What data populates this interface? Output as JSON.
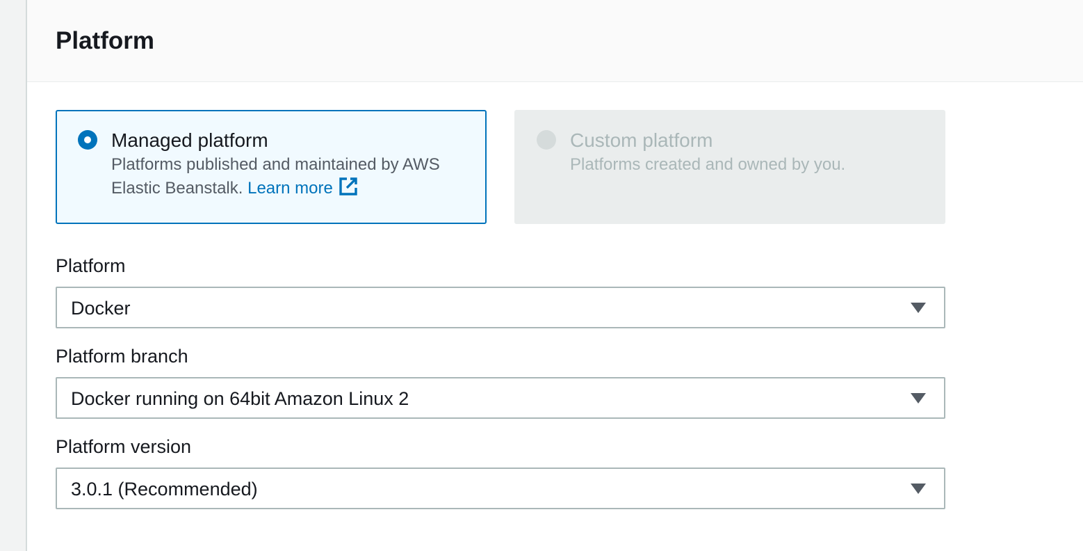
{
  "section": {
    "title": "Platform"
  },
  "tiles": {
    "managed": {
      "title": "Managed platform",
      "description": "Platforms published and maintained by AWS Elastic Beanstalk.",
      "link_label": "Learn more",
      "selected": true,
      "icon": "external-link-icon"
    },
    "custom": {
      "title": "Custom platform",
      "description": "Platforms created and owned by you.",
      "disabled": true
    }
  },
  "fields": {
    "platform": {
      "label": "Platform",
      "value": "Docker"
    },
    "platform_branch": {
      "label": "Platform branch",
      "value": "Docker running on 64bit Amazon Linux 2"
    },
    "platform_version": {
      "label": "Platform version",
      "value": "3.0.1 (Recommended)"
    }
  },
  "colors": {
    "accent": "#0073bb",
    "selected_tile_bg": "#f1faff",
    "disabled_tile_bg": "#eaeded",
    "disabled_text": "#aab7b8"
  }
}
